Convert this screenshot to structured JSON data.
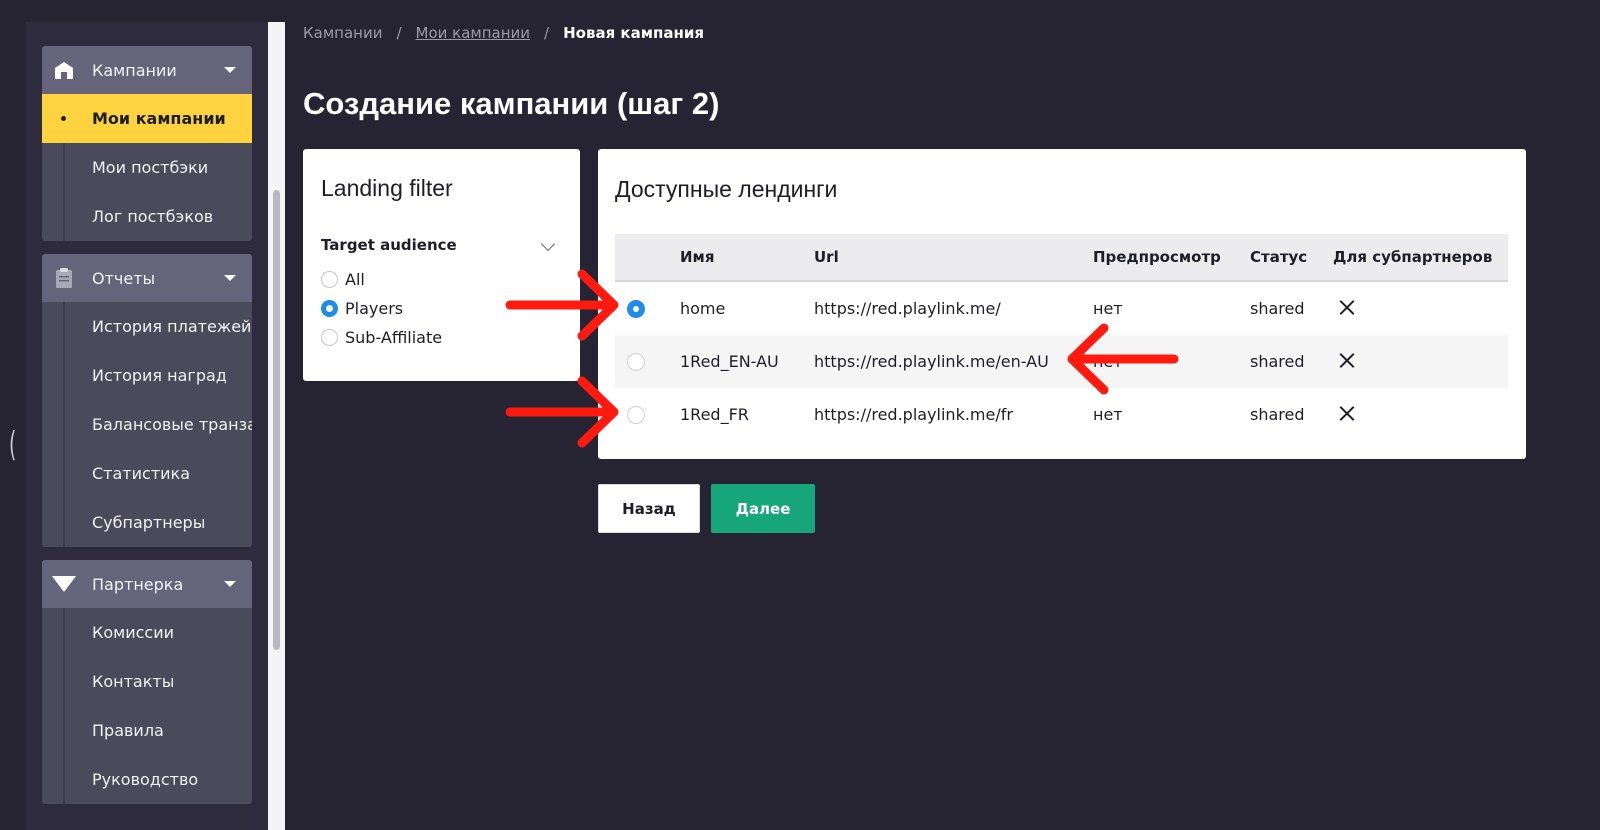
{
  "sidebar": {
    "groups": [
      {
        "label": "Кампании",
        "icon": "store-icon",
        "items": [
          "Мои кампании",
          "Мои постбэки",
          "Лог постбэков"
        ],
        "active_index": 0
      },
      {
        "label": "Отчеты",
        "icon": "clipboard-icon",
        "items": [
          "История платежей",
          "История наград",
          "Балансовые транзакци",
          "Статистика",
          "Субпартнеры"
        ]
      },
      {
        "label": "Партнерка",
        "icon": "funnel-icon",
        "items": [
          "Комиссии",
          "Контакты",
          "Правила",
          "Руководство"
        ]
      }
    ]
  },
  "breadcrumb": {
    "items": [
      "Кампании",
      "Мои кампании",
      "Новая кампания"
    ],
    "separator": "/"
  },
  "page": {
    "title": "Создание кампании (шаг 2)"
  },
  "filter": {
    "title": "Landing filter",
    "label": "Target audience",
    "options": [
      "All",
      "Players",
      "Sub-Affiliate"
    ],
    "selected": "Players"
  },
  "landings": {
    "title": "Доступные лендинги",
    "columns": [
      "Имя",
      "Url",
      "Предпросмотр",
      "Статус",
      "Для субпартнеров"
    ],
    "rows": [
      {
        "name": "home",
        "url": "https://red.playlink.me/",
        "preview": "нет",
        "status": "shared",
        "sub": "close-icon",
        "selected": true
      },
      {
        "name": "1Red_EN-AU",
        "url": "https://red.playlink.me/en-AU",
        "preview": "нет",
        "status": "shared",
        "sub": "close-icon",
        "selected": false
      },
      {
        "name": "1Red_FR",
        "url": "https://red.playlink.me/fr",
        "preview": "нет",
        "status": "shared",
        "sub": "close-icon",
        "selected": false
      }
    ]
  },
  "buttons": {
    "back": "Назад",
    "next": "Далее"
  },
  "colors": {
    "background": "#262432",
    "sidebar_group": "#4b4a5b",
    "sidebar_header": "#65647a",
    "active_item": "#ffd23f",
    "primary_button": "#17a57a",
    "radio_selected": "#1e8ce8",
    "annotation_arrow": "#ff1a0f"
  }
}
